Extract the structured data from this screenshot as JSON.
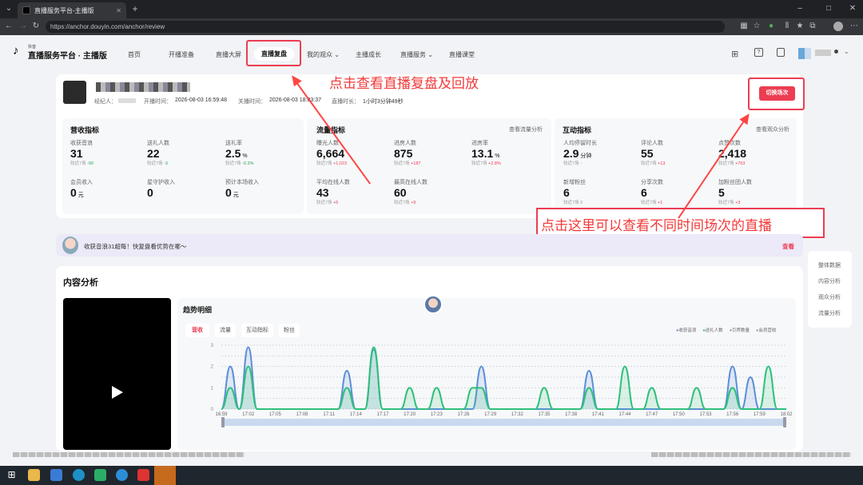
{
  "browser": {
    "tab_title": "直播服务平台-主播版",
    "url": "https://anchor.douyin.com/anchor/review"
  },
  "nav": {
    "logo_small": "抖音",
    "logo_title": "直播服务平台 · 主播版",
    "items": [
      "首页",
      "开播准备",
      "直播大屏",
      "直播复盘",
      "我的观众",
      "主播成长",
      "直播服务",
      "直播课堂"
    ]
  },
  "session": {
    "manager_label": "经纪人：",
    "start_label": "开播时间：",
    "start_time": "2026-08-03 16:59:48",
    "end_label": "关播时间：",
    "end_time": "2026-08-03 18:03:37",
    "duration_label": "直播时长：",
    "duration": "1小时3分钟49秒",
    "switch_button": "切换场次"
  },
  "revenue": {
    "title": "营收指标",
    "metrics": [
      {
        "label": "收获音浪",
        "value": "31",
        "unit": "",
        "cmp": "较近7场",
        "delta": "-90",
        "tone": "green"
      },
      {
        "label": "送礼人数",
        "value": "22",
        "unit": "",
        "cmp": "较近7场",
        "delta": "-3",
        "tone": "green"
      },
      {
        "label": "送礼率",
        "value": "2.5",
        "unit": "%",
        "cmp": "较近7场",
        "delta": "-0.3%",
        "tone": "green"
      },
      {
        "label": "会员收入",
        "value": "0",
        "unit": "元",
        "cmp": "",
        "delta": "",
        "tone": ""
      },
      {
        "label": "星守护收入",
        "value": "0",
        "unit": "",
        "cmp": "",
        "delta": "",
        "tone": ""
      },
      {
        "label": "预计本场收入",
        "value": "0",
        "unit": "元",
        "cmp": "",
        "delta": "",
        "tone": ""
      }
    ]
  },
  "traffic": {
    "title": "流量指标",
    "link": "查看流量分析",
    "metrics": [
      {
        "label": "曝光人数",
        "value": "6,664",
        "unit": "",
        "cmp": "较近7场",
        "delta": "+1,023",
        "tone": "red"
      },
      {
        "label": "进房人数",
        "value": "875",
        "unit": "",
        "cmp": "较近7场",
        "delta": "+187",
        "tone": "red"
      },
      {
        "label": "进房率",
        "value": "13.1",
        "unit": "%",
        "cmp": "较近7场",
        "delta": "+2.8%",
        "tone": "red"
      },
      {
        "label": "平均在线人数",
        "value": "43",
        "unit": "",
        "cmp": "较近7场",
        "delta": "+5",
        "tone": "red"
      },
      {
        "label": "最高在线人数",
        "value": "60",
        "unit": "",
        "cmp": "较近7场",
        "delta": "+9",
        "tone": "red"
      }
    ]
  },
  "interaction": {
    "title": "互动指标",
    "link": "查看观众分析",
    "metrics": [
      {
        "label": "人均停留时长",
        "value": "2.9",
        "unit": "分钟",
        "cmp": "较近7场",
        "delta": "-",
        "tone": ""
      },
      {
        "label": "评论人数",
        "value": "55",
        "unit": "",
        "cmp": "较近7场",
        "delta": "+13",
        "tone": "red"
      },
      {
        "label": "点赞次数",
        "value": "2,418",
        "unit": "",
        "cmp": "较近7场",
        "delta": "+763",
        "tone": "red"
      },
      {
        "label": "新增粉丝",
        "value": "6",
        "unit": "",
        "cmp": "较近7场",
        "delta": "0",
        "tone": ""
      },
      {
        "label": "分享次数",
        "value": "6",
        "unit": "",
        "cmp": "较近7场",
        "delta": "+1",
        "tone": "red"
      },
      {
        "label": "加粉丝团人数",
        "value": "5",
        "unit": "",
        "cmp": "较近7场",
        "delta": "+3",
        "tone": "red"
      }
    ]
  },
  "annotations": {
    "top": "点击查看直播复盘及回放",
    "right": "点击这里可以查看不同时间场次的直播"
  },
  "banner": {
    "text": "收获音浪31超每！快复盘看优势在哪～",
    "link": "查看"
  },
  "side_nav": [
    "整体数据",
    "内容分析",
    "观众分析",
    "流量分析"
  ],
  "content": {
    "title": "内容分析",
    "trend_title": "趋势明细",
    "tabs": [
      "营收",
      "流量",
      "互动指标",
      "粉丝"
    ],
    "legend": [
      "收获音浪",
      "送礼人数",
      "引荐数量",
      "会员营收"
    ]
  },
  "colors": {
    "accent": "#ec3d52",
    "series_blue": "#5b8fd9",
    "series_green": "#2fc07a",
    "annotation": "#f23a3a"
  },
  "chart_data": {
    "type": "area",
    "x": [
      "16:59",
      "17:02",
      "17:05",
      "17:08",
      "17:11",
      "17:14",
      "17:17",
      "17:20",
      "17:23",
      "17:26",
      "17:29",
      "17:32",
      "17:35",
      "17:38",
      "17:41",
      "17:44",
      "17:47",
      "17:50",
      "17:53",
      "17:56",
      "17:59",
      "18:02"
    ],
    "ylim": [
      0,
      3
    ],
    "yticks": [
      0,
      0.5,
      1,
      1.5,
      2,
      2.5,
      3
    ],
    "series": [
      {
        "name": "收获音浪",
        "color": "#5b8fd9",
        "points": [
          [
            0,
            0
          ],
          [
            1,
            2.0
          ],
          [
            2,
            0
          ],
          [
            3,
            2.9
          ],
          [
            4,
            0
          ],
          [
            13,
            0
          ],
          [
            14,
            1.8
          ],
          [
            15,
            0
          ],
          [
            16,
            0
          ],
          [
            17,
            2.8
          ],
          [
            18,
            0
          ],
          [
            28,
            0
          ],
          [
            29,
            2.0
          ],
          [
            30,
            0
          ],
          [
            31,
            0
          ],
          [
            32,
            0
          ],
          [
            33,
            0
          ],
          [
            34,
            0
          ],
          [
            35,
            0
          ],
          [
            40,
            0
          ],
          [
            41,
            1.8
          ],
          [
            42,
            0
          ],
          [
            43,
            0
          ],
          [
            44,
            0
          ],
          [
            45,
            0
          ],
          [
            48,
            0
          ],
          [
            49,
            0
          ],
          [
            50,
            0
          ],
          [
            51,
            0
          ],
          [
            52,
            0
          ],
          [
            56,
            0
          ],
          [
            57,
            2.0
          ],
          [
            58,
            0
          ],
          [
            59,
            1.5
          ],
          [
            60,
            0
          ],
          [
            61,
            0
          ],
          [
            62,
            0
          ],
          [
            63,
            0
          ]
        ]
      },
      {
        "name": "送礼人数",
        "color": "#2fc07a",
        "points": [
          [
            0,
            0
          ],
          [
            1,
            1.0
          ],
          [
            2,
            0
          ],
          [
            3,
            2.0
          ],
          [
            4,
            0
          ],
          [
            13,
            0
          ],
          [
            14,
            1.0
          ],
          [
            15,
            0
          ],
          [
            16,
            0
          ],
          [
            17,
            2.9
          ],
          [
            18,
            0
          ],
          [
            20,
            0
          ],
          [
            21,
            1.0
          ],
          [
            22,
            0
          ],
          [
            23,
            0
          ],
          [
            24,
            1.0
          ],
          [
            25,
            0
          ],
          [
            27,
            0
          ],
          [
            28,
            1.0
          ],
          [
            29,
            1.0
          ],
          [
            30,
            0
          ],
          [
            35,
            0
          ],
          [
            36,
            1.0
          ],
          [
            37,
            0
          ],
          [
            38,
            0
          ],
          [
            39,
            0
          ],
          [
            40,
            0
          ],
          [
            41,
            1.0
          ],
          [
            42,
            0
          ],
          [
            43,
            0
          ],
          [
            44,
            0
          ],
          [
            45,
            2.0
          ],
          [
            46,
            0
          ],
          [
            47,
            0
          ],
          [
            48,
            1.0
          ],
          [
            49,
            0
          ],
          [
            52,
            0
          ],
          [
            53,
            1.0
          ],
          [
            54,
            0
          ],
          [
            56,
            0
          ],
          [
            57,
            1.0
          ],
          [
            58,
            0
          ],
          [
            60,
            0
          ],
          [
            61,
            2.0
          ],
          [
            62,
            0
          ],
          [
            63,
            0
          ]
        ]
      }
    ]
  }
}
